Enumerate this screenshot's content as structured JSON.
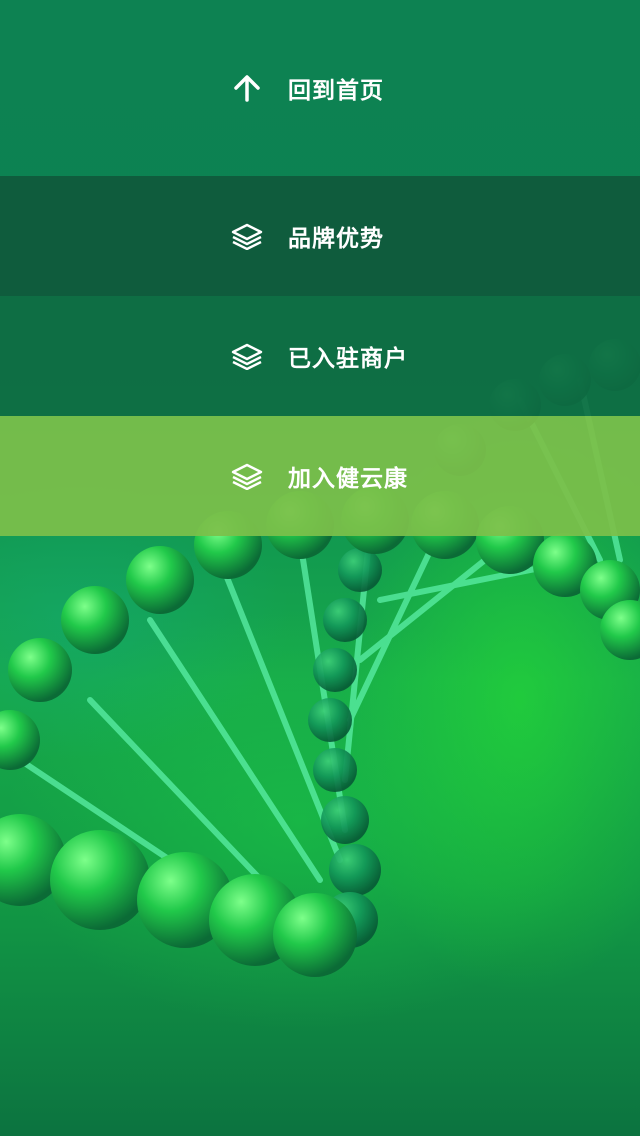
{
  "menu": {
    "items": [
      {
        "label": "回到首页",
        "icon": "arrow-up-icon"
      },
      {
        "label": "品牌优势",
        "icon": "layers-icon"
      },
      {
        "label": "已入驻商户",
        "icon": "layers-icon"
      },
      {
        "label": "加入健云康",
        "icon": "layers-icon",
        "highlighted": true
      }
    ]
  },
  "colors": {
    "home_bg": "#0d8252",
    "brand_bg": "#0f5c3d",
    "merchants_bg": "#0e6b43",
    "join_bg": "#7cc04a",
    "text": "#ffffff"
  },
  "background": {
    "image": "dna-helix-illustration"
  }
}
